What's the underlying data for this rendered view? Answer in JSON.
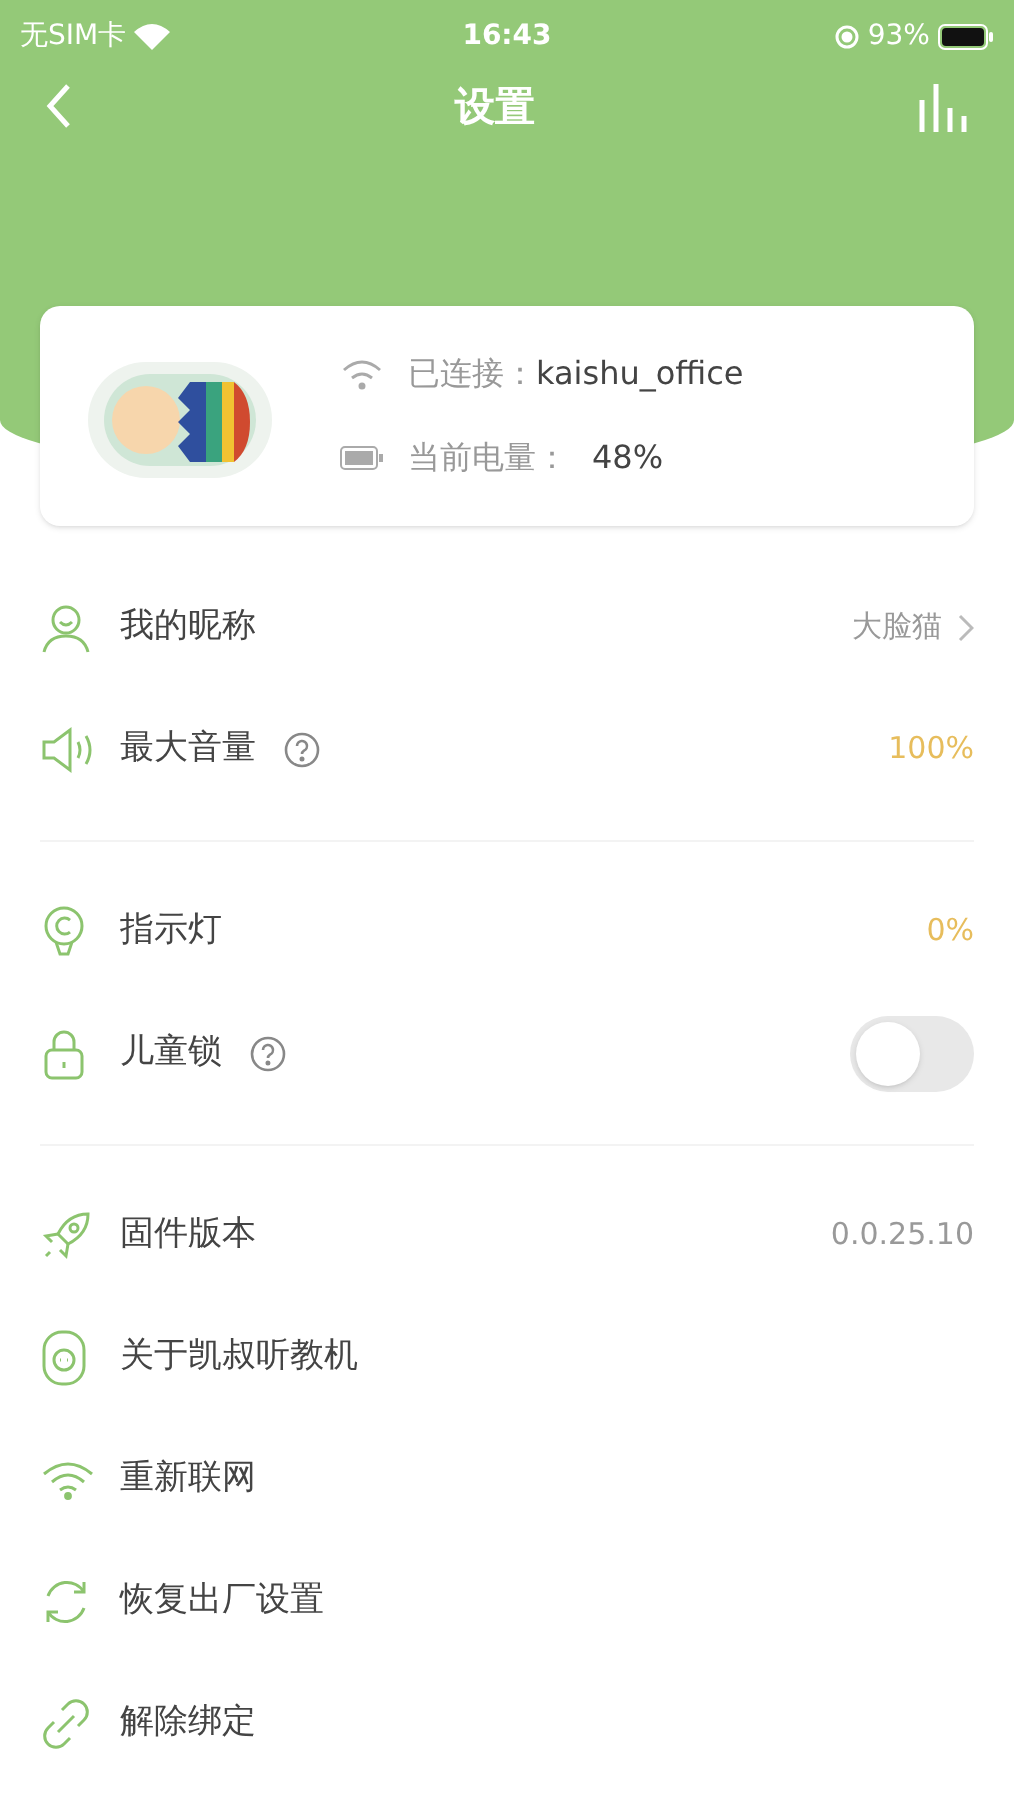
{
  "status_bar": {
    "carrier": "无SIM卡",
    "time": "16:43",
    "battery": "93%"
  },
  "nav": {
    "title": "设置"
  },
  "device_card": {
    "wifi_label": "已连接：",
    "wifi_name": "kaishu_office",
    "battery_label": "当前电量：",
    "battery_value": "48%"
  },
  "groups": [
    [
      {
        "kind": "nav",
        "label": "我的昵称",
        "value": "大脸猫"
      },
      {
        "kind": "value",
        "label": "最大音量",
        "help": true,
        "value": "100%"
      }
    ],
    [
      {
        "kind": "value",
        "label": "指示灯",
        "value": "0%"
      },
      {
        "kind": "toggle",
        "label": "儿童锁",
        "help": true,
        "on": false
      }
    ],
    [
      {
        "kind": "info",
        "label": "固件版本",
        "value": "0.0.25.10"
      },
      {
        "kind": "plain",
        "label": "关于凯叔听教机"
      },
      {
        "kind": "plain",
        "label": "重新联网"
      },
      {
        "kind": "plain",
        "label": "恢复出厂设置"
      },
      {
        "kind": "plain",
        "label": "解除绑定"
      }
    ]
  ]
}
